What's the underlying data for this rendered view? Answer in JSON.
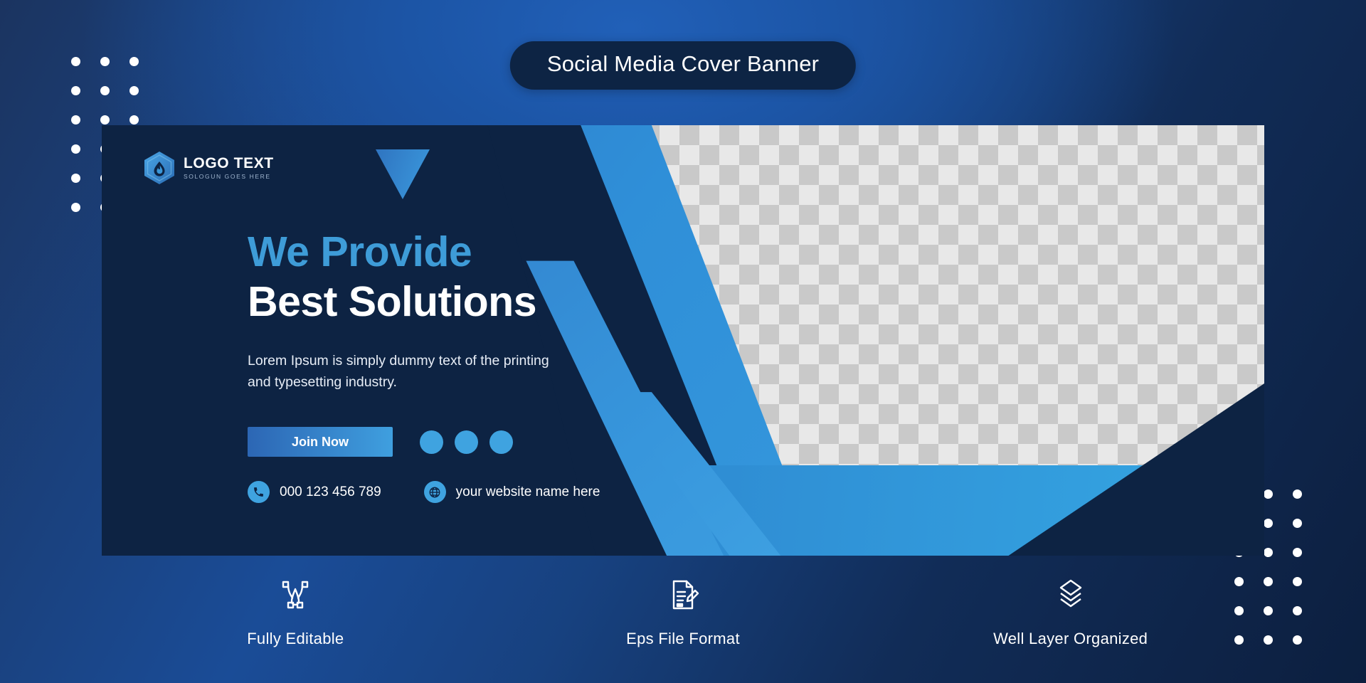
{
  "page": {
    "title": "Social Media Cover Banner",
    "background_colors": {
      "dark_navy": "#1b3460",
      "mid_blue": "#1a54a8",
      "deep_navy": "#0c1f3f"
    }
  },
  "banner": {
    "background": "#0d2343",
    "accent_blue": "#3fa3e0",
    "logo": {
      "name": "LOGO TEXT",
      "slogan": "SOLOGUN GOES HERE",
      "mark_icon": "hexagon-droplet-icon"
    },
    "headline": {
      "line1": "We Provide",
      "line2": "Best Solutions",
      "line1_color": "#3e9cd8",
      "line2_color": "#ffffff"
    },
    "paragraph": "Lorem Ipsum is simply dummy text of the printing and typesetting industry.",
    "cta": {
      "join_label": "Join Now",
      "social_dots": 3
    },
    "contact": {
      "phone_icon": "phone-icon",
      "phone": "000 123 456 789",
      "website_icon": "globe-icon",
      "website": "your website name here"
    },
    "photo_placeholder": "transparent-checkerboard"
  },
  "features": [
    {
      "icon": "pen-tool-icon",
      "label": "Fully Editable"
    },
    {
      "icon": "document-pencil-icon",
      "label": "Eps File Format"
    },
    {
      "icon": "layers-icon",
      "label": "Well Layer Organized"
    }
  ]
}
